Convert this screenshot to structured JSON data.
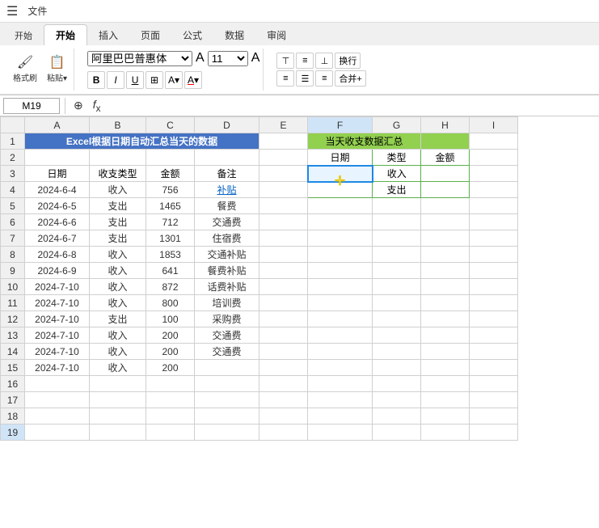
{
  "titlebar": {
    "menu_items": [
      "文件",
      "开始",
      "插入",
      "页面",
      "公式",
      "数据",
      "审阅"
    ]
  },
  "ribbon": {
    "active_tab": "开始",
    "font": {
      "name": "阿里巴巴普惠体",
      "size": "11",
      "bold": "B",
      "italic": "I",
      "underline": "U"
    },
    "wrap_label": "换行",
    "merge_label": "合并+"
  },
  "formula_bar": {
    "cell_ref": "M19",
    "formula": ""
  },
  "columns": [
    "A",
    "B",
    "C",
    "D",
    "E",
    "F",
    "G",
    "H",
    "I"
  ],
  "rows": [
    {
      "row": 1,
      "cells": [
        {
          "col": "A",
          "colspan": 4,
          "value": "Excel根据日期自动汇总当天的数据",
          "style": "blue-title"
        },
        {
          "col": "E",
          "value": ""
        },
        {
          "col": "F",
          "colspan": 2,
          "value": "当天收支数据汇总",
          "style": "green-header"
        },
        {
          "col": "H",
          "value": ""
        }
      ]
    },
    {
      "row": 2,
      "cells": [
        {
          "col": "A",
          "value": ""
        },
        {
          "col": "B",
          "value": ""
        },
        {
          "col": "C",
          "value": ""
        },
        {
          "col": "D",
          "value": ""
        },
        {
          "col": "E",
          "value": ""
        },
        {
          "col": "F",
          "value": "日期",
          "style": "summary-label"
        },
        {
          "col": "G",
          "value": "类型",
          "style": "summary-label"
        },
        {
          "col": "H",
          "value": "金额",
          "style": "summary-label"
        }
      ]
    },
    {
      "row": 3,
      "cells": [
        {
          "col": "A",
          "value": "日期",
          "style": "header"
        },
        {
          "col": "B",
          "value": "收支类型",
          "style": "header"
        },
        {
          "col": "C",
          "value": "金额",
          "style": "header"
        },
        {
          "col": "D",
          "value": "备注",
          "style": "header"
        },
        {
          "col": "E",
          "value": ""
        },
        {
          "col": "F",
          "value": "",
          "style": "cursor-cell"
        },
        {
          "col": "G",
          "value": "收入",
          "style": "summary-label"
        },
        {
          "col": "H",
          "value": ""
        }
      ]
    },
    {
      "row": 4,
      "cells": [
        {
          "col": "A",
          "value": "2024-6-4",
          "style": "date"
        },
        {
          "col": "B",
          "value": "收入",
          "style": "type"
        },
        {
          "col": "C",
          "value": "756",
          "style": "amount"
        },
        {
          "col": "D",
          "value": "补贴",
          "style": "note"
        },
        {
          "col": "E",
          "value": ""
        },
        {
          "col": "F",
          "value": ""
        },
        {
          "col": "G",
          "value": "支出",
          "style": "summary-label"
        },
        {
          "col": "H",
          "value": ""
        }
      ]
    },
    {
      "row": 5,
      "cells": [
        {
          "col": "A",
          "value": "2024-6-5",
          "style": "date"
        },
        {
          "col": "B",
          "value": "支出",
          "style": "type"
        },
        {
          "col": "C",
          "value": "1465",
          "style": "amount"
        },
        {
          "col": "D",
          "value": "餐费",
          "style": "note-plain"
        },
        {
          "col": "E",
          "value": ""
        },
        {
          "col": "F",
          "value": ""
        },
        {
          "col": "G",
          "value": ""
        },
        {
          "col": "H",
          "value": ""
        }
      ]
    },
    {
      "row": 6,
      "cells": [
        {
          "col": "A",
          "value": "2024-6-6",
          "style": "date"
        },
        {
          "col": "B",
          "value": "支出",
          "style": "type"
        },
        {
          "col": "C",
          "value": "712",
          "style": "amount"
        },
        {
          "col": "D",
          "value": "交通费",
          "style": "note-plain"
        },
        {
          "col": "E",
          "value": ""
        },
        {
          "col": "F",
          "value": ""
        },
        {
          "col": "G",
          "value": ""
        },
        {
          "col": "H",
          "value": ""
        }
      ]
    },
    {
      "row": 7,
      "cells": [
        {
          "col": "A",
          "value": "2024-6-7",
          "style": "date"
        },
        {
          "col": "B",
          "value": "支出",
          "style": "type"
        },
        {
          "col": "C",
          "value": "1301",
          "style": "amount"
        },
        {
          "col": "D",
          "value": "住宿费",
          "style": "note-plain"
        },
        {
          "col": "E",
          "value": ""
        },
        {
          "col": "F",
          "value": ""
        },
        {
          "col": "G",
          "value": ""
        },
        {
          "col": "H",
          "value": ""
        }
      ]
    },
    {
      "row": 8,
      "cells": [
        {
          "col": "A",
          "value": "2024-6-8",
          "style": "date"
        },
        {
          "col": "B",
          "value": "收入",
          "style": "type"
        },
        {
          "col": "C",
          "value": "1853",
          "style": "amount"
        },
        {
          "col": "D",
          "value": "交通补贴",
          "style": "note-plain"
        },
        {
          "col": "E",
          "value": ""
        },
        {
          "col": "F",
          "value": ""
        },
        {
          "col": "G",
          "value": ""
        },
        {
          "col": "H",
          "value": ""
        }
      ]
    },
    {
      "row": 9,
      "cells": [
        {
          "col": "A",
          "value": "2024-6-9",
          "style": "date"
        },
        {
          "col": "B",
          "value": "收入",
          "style": "type"
        },
        {
          "col": "C",
          "value": "641",
          "style": "amount"
        },
        {
          "col": "D",
          "value": "餐费补贴",
          "style": "note-plain"
        },
        {
          "col": "E",
          "value": ""
        },
        {
          "col": "F",
          "value": ""
        },
        {
          "col": "G",
          "value": ""
        },
        {
          "col": "H",
          "value": ""
        }
      ]
    },
    {
      "row": 10,
      "cells": [
        {
          "col": "A",
          "value": "2024-7-10",
          "style": "date"
        },
        {
          "col": "B",
          "value": "收入",
          "style": "type"
        },
        {
          "col": "C",
          "value": "872",
          "style": "amount"
        },
        {
          "col": "D",
          "value": "话费补贴",
          "style": "note-plain"
        },
        {
          "col": "E",
          "value": ""
        },
        {
          "col": "F",
          "value": ""
        },
        {
          "col": "G",
          "value": ""
        },
        {
          "col": "H",
          "value": ""
        }
      ]
    },
    {
      "row": 11,
      "cells": [
        {
          "col": "A",
          "value": "2024-7-10",
          "style": "date"
        },
        {
          "col": "B",
          "value": "收入",
          "style": "type"
        },
        {
          "col": "C",
          "value": "800",
          "style": "amount"
        },
        {
          "col": "D",
          "value": "培训费",
          "style": "note-plain"
        },
        {
          "col": "E",
          "value": ""
        },
        {
          "col": "F",
          "value": ""
        },
        {
          "col": "G",
          "value": ""
        },
        {
          "col": "H",
          "value": ""
        }
      ]
    },
    {
      "row": 12,
      "cells": [
        {
          "col": "A",
          "value": "2024-7-10",
          "style": "date"
        },
        {
          "col": "B",
          "value": "支出",
          "style": "type"
        },
        {
          "col": "C",
          "value": "100",
          "style": "amount"
        },
        {
          "col": "D",
          "value": "采购费",
          "style": "note-plain"
        },
        {
          "col": "E",
          "value": ""
        },
        {
          "col": "F",
          "value": ""
        },
        {
          "col": "G",
          "value": ""
        },
        {
          "col": "H",
          "value": ""
        }
      ]
    },
    {
      "row": 13,
      "cells": [
        {
          "col": "A",
          "value": "2024-7-10",
          "style": "date"
        },
        {
          "col": "B",
          "value": "收入",
          "style": "type"
        },
        {
          "col": "C",
          "value": "200",
          "style": "amount"
        },
        {
          "col": "D",
          "value": "交通费",
          "style": "note-plain"
        },
        {
          "col": "E",
          "value": ""
        },
        {
          "col": "F",
          "value": ""
        },
        {
          "col": "G",
          "value": ""
        },
        {
          "col": "H",
          "value": ""
        }
      ]
    },
    {
      "row": 14,
      "cells": [
        {
          "col": "A",
          "value": "2024-7-10",
          "style": "date"
        },
        {
          "col": "B",
          "value": "收入",
          "style": "type"
        },
        {
          "col": "C",
          "value": "200",
          "style": "amount"
        },
        {
          "col": "D",
          "value": "交通费",
          "style": "note-plain"
        },
        {
          "col": "E",
          "value": ""
        },
        {
          "col": "F",
          "value": ""
        },
        {
          "col": "G",
          "value": ""
        },
        {
          "col": "H",
          "value": ""
        }
      ]
    },
    {
      "row": 15,
      "cells": [
        {
          "col": "A",
          "value": "2024-7-10",
          "style": "date"
        },
        {
          "col": "B",
          "value": "收入",
          "style": "type"
        },
        {
          "col": "C",
          "value": "200",
          "style": "amount"
        },
        {
          "col": "D",
          "value": "",
          "style": ""
        },
        {
          "col": "E",
          "value": ""
        },
        {
          "col": "F",
          "value": ""
        },
        {
          "col": "G",
          "value": ""
        },
        {
          "col": "H",
          "value": ""
        }
      ]
    },
    {
      "row": 16,
      "cells": []
    },
    {
      "row": 17,
      "cells": []
    },
    {
      "row": 18,
      "cells": []
    },
    {
      "row": 19,
      "cells": []
    }
  ]
}
